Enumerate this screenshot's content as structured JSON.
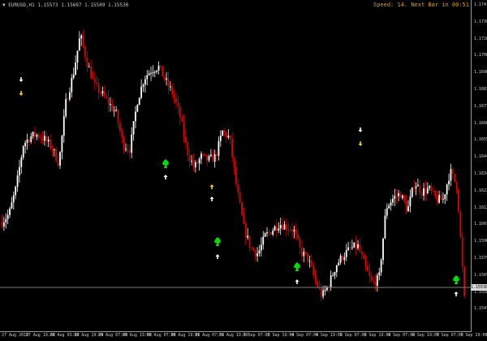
{
  "window": {
    "symbol_info": "▼ EURUSD,H1  1.15573 1.15697 1.15509 1.15530",
    "timer_text": "Speed: 14. Next Bar in 00:51"
  },
  "price_axis": {
    "labels": [
      "1.17410",
      "1.17305",
      "1.17200",
      "1.17085",
      "1.16980",
      "1.16875",
      "1.16770",
      "1.16665",
      "1.16550",
      "1.16445",
      "1.16340",
      "1.16225",
      "1.16120",
      "1.16015",
      "1.15900",
      "1.15795",
      "1.15690",
      "1.15585",
      "1.15470"
    ],
    "current_price": "1.15530"
  },
  "time_axis": {
    "labels": [
      "27 Aug 2018",
      "27 Aug 19:00",
      "28 Aug 03:00",
      "28 Aug 19:00",
      "29 Aug 07:00",
      "29 Aug 19:00",
      "30 Aug 07:00",
      "30 Aug 19:00",
      "31 Aug 07:00",
      "31 Aug 19:00",
      "3 Sep 07:00",
      "3 Sep 19:00",
      "4 Sep 07:00",
      "4 Sep 19:00",
      "5 Sep 07:00",
      "5 Sep 19:00",
      "6 Sep 07:00",
      "6 Sep 19:00",
      "7 Sep 07:00",
      "7 Sep 19:00"
    ]
  },
  "colors": {
    "background": "#000000",
    "bull": "#ffffff",
    "bear": "#e00000",
    "signal_green": "#00e000",
    "signal_yellow": "#ffd000",
    "signal_white": "#ffffff",
    "price_line": "#808080"
  },
  "chart_data": {
    "type": "candlestick",
    "y_range": [
      1.1543,
      1.1746
    ],
    "path_y_values": [
      1.1609,
      1.1614,
      1.1631,
      1.1658,
      1.1663,
      1.1664,
      1.1661,
      1.1656,
      1.1646,
      1.1685,
      1.1702,
      1.1727,
      1.1709,
      1.1695,
      1.169,
      1.1684,
      1.1678,
      1.1658,
      1.1655,
      1.1685,
      1.17,
      1.1705,
      1.1707,
      1.1698,
      1.169,
      1.1676,
      1.1654,
      1.1643,
      1.165,
      1.1648,
      1.165,
      1.1666,
      1.1662,
      1.163,
      1.1605,
      1.1592,
      1.1589,
      1.16,
      1.1604,
      1.1608,
      1.1606,
      1.1604,
      1.159,
      1.1586,
      1.1572,
      1.1562,
      1.157,
      1.1582,
      1.1588,
      1.1592,
      1.1594,
      1.1581,
      1.157,
      1.1573,
      1.1618,
      1.1624,
      1.1627,
      1.1616,
      1.1634,
      1.1628,
      1.163,
      1.1623,
      1.1623,
      1.1641,
      1.1631,
      1.156
    ],
    "signals": [
      {
        "kind": "arrow-down",
        "color": "white",
        "x_label": "27 Aug 19:00"
      },
      {
        "kind": "arrow-down",
        "color": "yellow",
        "x_label": "27 Aug 19:00"
      },
      {
        "kind": "spade",
        "color": "green",
        "x_label": "30 Aug 07:00"
      },
      {
        "kind": "arrow-up",
        "color": "white",
        "x_label": "30 Aug 07:00"
      },
      {
        "kind": "arrow-up",
        "color": "yellow",
        "x_label": "31 Aug 07:00"
      },
      {
        "kind": "arrow-up",
        "color": "white",
        "x_label": "31 Aug 07:00"
      },
      {
        "kind": "spade",
        "color": "green",
        "x_label": "31 Aug 19:00"
      },
      {
        "kind": "arrow-up",
        "color": "white",
        "x_label": "31 Aug 19:00"
      },
      {
        "kind": "spade",
        "color": "green",
        "x_label": "4 Sep 07:00"
      },
      {
        "kind": "arrow-up",
        "color": "white",
        "x_label": "4 Sep 07:00"
      },
      {
        "kind": "arrow-down",
        "color": "white",
        "x_label": "5 Sep 19:00"
      },
      {
        "kind": "arrow-down",
        "color": "yellow",
        "x_label": "5 Sep 19:00"
      },
      {
        "kind": "spade",
        "color": "green",
        "x_label": "7 Sep 19:00"
      },
      {
        "kind": "arrow-up",
        "color": "white",
        "x_label": "7 Sep 19:00"
      }
    ]
  }
}
